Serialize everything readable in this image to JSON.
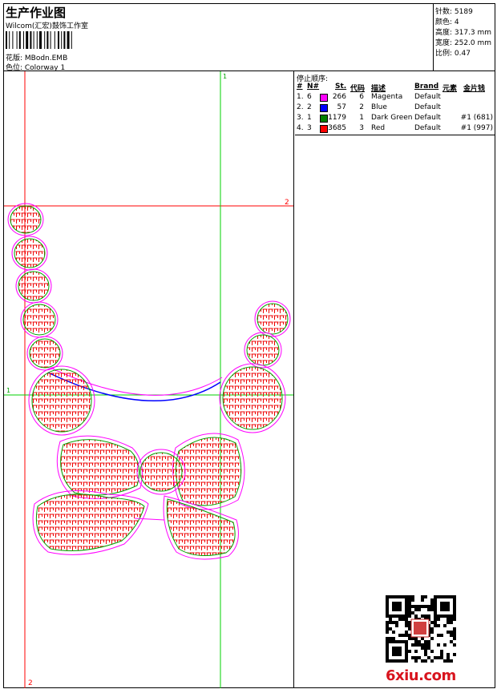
{
  "header": {
    "title": "生产作业图",
    "subtitle": "Wilcom(汇宏)鼓饰工作室",
    "design_file": "花版:  MBodn.EMB",
    "colorway": "色位:  Colorway 1"
  },
  "stats": {
    "stitches": "针数: 5189",
    "colors": "颜色: 4",
    "height": "高度: 317.3 mm",
    "width": "宽度: 252.0 mm",
    "scale": "比例: 0.47"
  },
  "sequence": {
    "title": "停止顺序:",
    "headers": {
      "num": "#",
      "n": "N#",
      "st": "St.",
      "code": "代码",
      "desc": "描述",
      "brand": "Brand",
      "element": "元素",
      "sequin": "金片钱"
    },
    "rows": [
      {
        "num": "1.",
        "n": "6",
        "color": "#ff00ff",
        "st": "266",
        "code": "6",
        "desc": "Magenta",
        "brand": "Default",
        "sequin": ""
      },
      {
        "num": "2.",
        "n": "2",
        "color": "#0000ff",
        "st": "57",
        "code": "2",
        "desc": "Blue",
        "brand": "Default",
        "sequin": ""
      },
      {
        "num": "3.",
        "n": "1",
        "color": "#008000",
        "st": "1179",
        "code": "1",
        "desc": "Dark Green",
        "brand": "Default",
        "sequin": "#1 (681)"
      },
      {
        "num": "4.",
        "n": "3",
        "color": "#ff0000",
        "st": "3685",
        "code": "3",
        "desc": "Red",
        "brand": "Default",
        "sequin": "#1 (997)"
      }
    ]
  },
  "design": {
    "guide_labels": {
      "top_green": "1",
      "left_green": "1",
      "right_red": "2",
      "bottom_red": "2"
    },
    "colors": {
      "guide_red": "#ff0000",
      "guide_green": "#00d000",
      "outline_magenta": "#ff00ff",
      "outline_green": "#00a000",
      "fill_red": "#ee0000",
      "line_blue": "#0000ff"
    }
  },
  "watermark": {
    "text": "6xiu.com",
    "icon": "qr-code-icon"
  }
}
